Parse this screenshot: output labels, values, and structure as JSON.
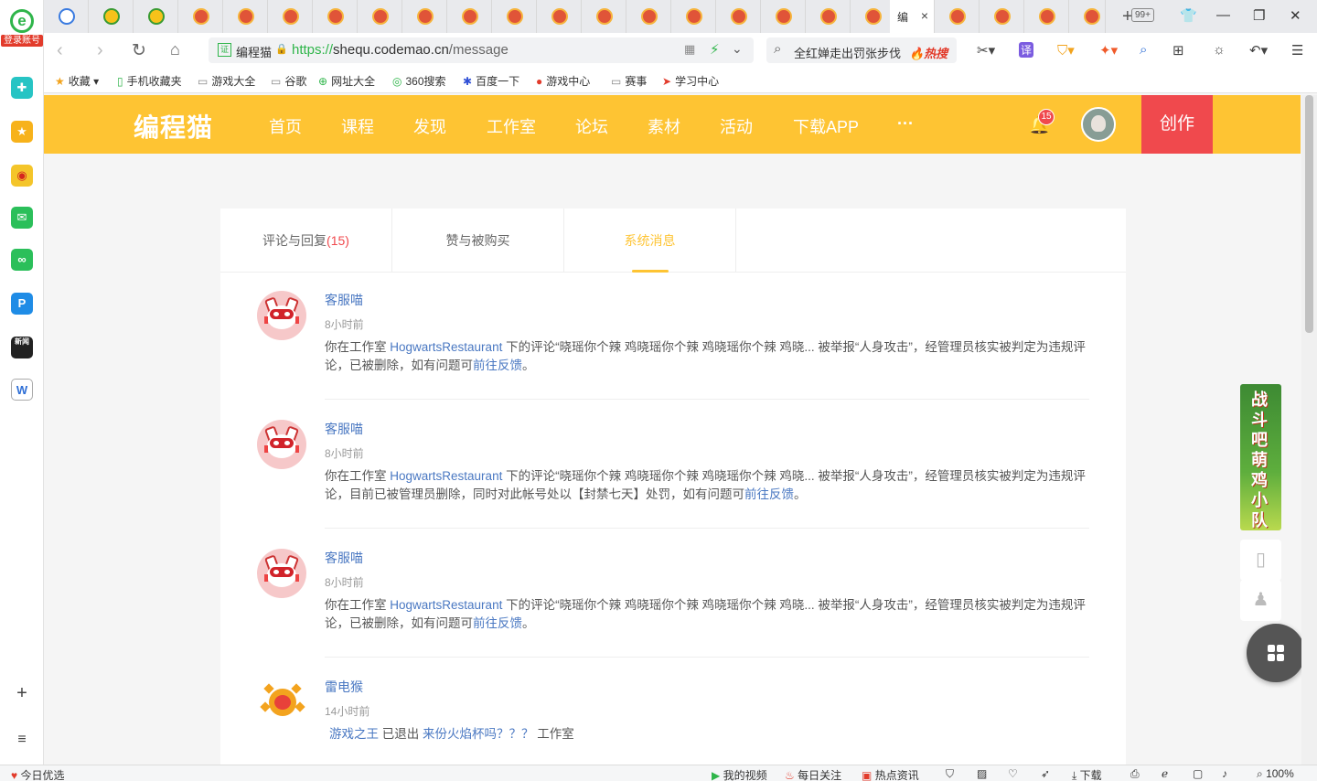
{
  "sidebar": {
    "login_label": "登录账号",
    "logo_glyph": "e"
  },
  "tabs": {
    "active_title": "编",
    "close": "×",
    "count": "99+",
    "new_tab": "+"
  },
  "window": {
    "min": "—",
    "max": "❐",
    "close": "✕",
    "skin": "👕"
  },
  "address": {
    "site_name": "编程猫",
    "scheme_host": "https://",
    "host": "shequ.codemao.cn",
    "path": "/message",
    "lock_glyph": "🔒"
  },
  "search": {
    "text": "全红婵走出罚张步伐",
    "hot": "🔥热搜"
  },
  "bookmarks": [
    {
      "label": "收藏",
      "icon": "star-icon"
    },
    {
      "label": "手机收藏夹",
      "icon": "phone-icon"
    },
    {
      "label": "游戏大全",
      "icon": "page-icon"
    },
    {
      "label": "谷歌",
      "icon": "page-icon"
    },
    {
      "label": "网址大全",
      "icon": "plus-circle-icon"
    },
    {
      "label": "360搜索",
      "icon": "search-icon"
    },
    {
      "label": "百度一下",
      "icon": "paw-icon"
    },
    {
      "label": "游戏中心",
      "icon": "game-icon"
    },
    {
      "label": "赛事",
      "icon": "page-icon"
    },
    {
      "label": "学习中心",
      "icon": "play-icon"
    }
  ],
  "site": {
    "logo": "编程猫",
    "nav": [
      "首页",
      "课程",
      "发现",
      "工作室",
      "论坛",
      "素材",
      "活动",
      "下载APP",
      "···"
    ],
    "notifications": "15",
    "create": "创作"
  },
  "message_tabs": [
    {
      "label": "评论与回复",
      "count": "(15)"
    },
    {
      "label": "赞与被购买",
      "count": ""
    },
    {
      "label": "系统消息",
      "count": ""
    }
  ],
  "messages": [
    {
      "name": "客服喵",
      "time": "8小时前",
      "pre": "你在工作室 ",
      "studio": "HogwartsRestaurant",
      "mid": " 下的评论“晓瑶你个辣 鸡晓瑶你个辣 鸡晓瑶你个辣 鸡晓...  被举报“人身攻击”，经管理员核实被判定为违规评论，已被删除，如有问题可",
      "link": "前往反馈",
      "end": "。"
    },
    {
      "name": "客服喵",
      "time": "8小时前",
      "pre": "你在工作室 ",
      "studio": "HogwartsRestaurant",
      "mid": " 下的评论“晓瑶你个辣 鸡晓瑶你个辣 鸡晓瑶你个辣 鸡晓... 被举报“人身攻击”，经管理员核实被判定为违规评论，目前已被管理员删除，同时对此帐号处以【封禁七天】处罚，如有问题可",
      "link": "前往反馈",
      "end": "。"
    },
    {
      "name": "客服喵",
      "time": "8小时前",
      "pre": "你在工作室 ",
      "studio": "HogwartsRestaurant",
      "mid": " 下的评论“晓瑶你个辣 鸡晓瑶你个辣 鸡晓瑶你个辣 鸡晓...  被举报“人身攻击”，经管理员核实被判定为违规评论，已被删除，如有问题可",
      "link": "前往反馈",
      "end": "。"
    },
    {
      "name": "雷电猴",
      "time": "14小时前",
      "user": "游戏之王",
      "mid": " 已退出 ",
      "studio": "来份火焰杯吗？？？",
      "end": " 工作室"
    }
  ],
  "ad": {
    "text": "战斗吧萌鸡小队"
  },
  "statusbar": {
    "left": "今日优选",
    "video": "我的视频",
    "follow": "每日关注",
    "news": "热点资讯",
    "download": "下载",
    "zoom": "100%"
  }
}
